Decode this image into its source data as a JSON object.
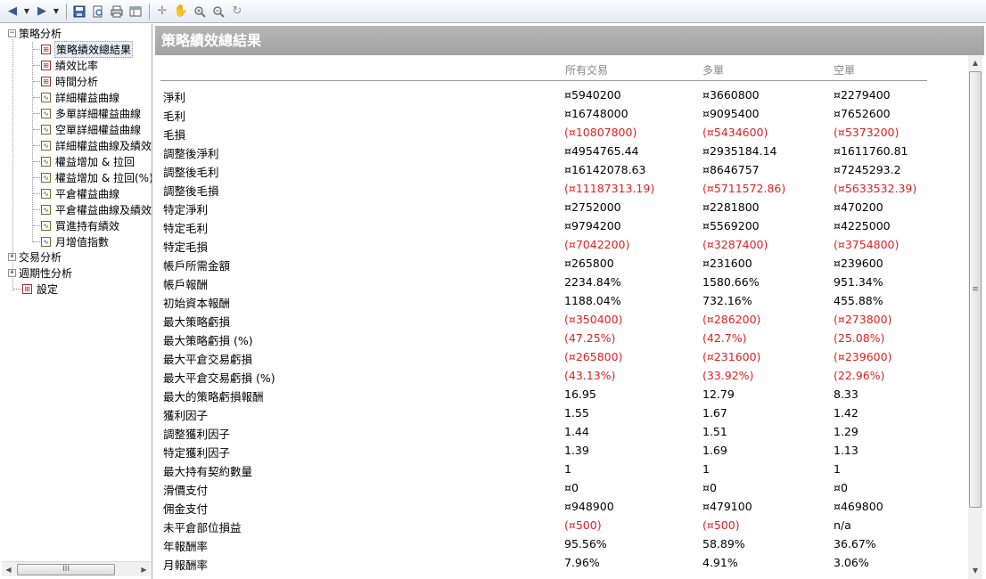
{
  "toolbar": {
    "icons": [
      "back-icon",
      "forward-icon",
      "save-icon",
      "print-preview-icon",
      "print-icon",
      "table-icon",
      "crosshair-icon",
      "pan-icon",
      "zoom-in-icon",
      "zoom-out-icon",
      "reset-icon"
    ]
  },
  "tree": {
    "root": "策略分析",
    "items": [
      "策略績效總結果",
      "績效比率",
      "時間分析",
      "詳細權益曲線",
      "多單詳細權益曲線",
      "空單詳細權益曲線",
      "詳細權益曲線及績效",
      "權益增加 & 拉回",
      "權益增加 & 拉回(%)",
      "平倉權益曲線",
      "平倉權益曲線及績效",
      "買進持有績效",
      "月增值指數"
    ],
    "others": [
      "交易分析",
      "週期性分析",
      "設定"
    ],
    "scroll_thumb": "III"
  },
  "main": {
    "title": "策略績效總結果",
    "columns": [
      "所有交易",
      "多單",
      "空單"
    ],
    "rows": [
      {
        "label": "淨利",
        "all": "¤5940200",
        "long": "¤3660800",
        "short": "¤2279400",
        "neg": false
      },
      {
        "label": "毛利",
        "all": "¤16748000",
        "long": "¤9095400",
        "short": "¤7652600",
        "neg": false
      },
      {
        "label": "毛損",
        "all": "(¤10807800)",
        "long": "(¤5434600)",
        "short": "(¤5373200)",
        "neg": true
      },
      {
        "label": "調整後淨利",
        "all": "¤4954765.44",
        "long": "¤2935184.14",
        "short": "¤1611760.81",
        "neg": false
      },
      {
        "label": "調整後毛利",
        "all": "¤16142078.63",
        "long": "¤8646757",
        "short": "¤7245293.2",
        "neg": false
      },
      {
        "label": "調整後毛損",
        "all": "(¤11187313.19)",
        "long": "(¤5711572.86)",
        "short": "(¤5633532.39)",
        "neg": true
      },
      {
        "label": "特定淨利",
        "all": "¤2752000",
        "long": "¤2281800",
        "short": "¤470200",
        "neg": false
      },
      {
        "label": "特定毛利",
        "all": "¤9794200",
        "long": "¤5569200",
        "short": "¤4225000",
        "neg": false
      },
      {
        "label": "特定毛損",
        "all": "(¤7042200)",
        "long": "(¤3287400)",
        "short": "(¤3754800)",
        "neg": true
      },
      {
        "label": "帳戶所需金額",
        "all": "¤265800",
        "long": "¤231600",
        "short": "¤239600",
        "neg": false
      },
      {
        "label": "帳戶報酬",
        "all": "2234.84%",
        "long": "1580.66%",
        "short": "951.34%",
        "neg": false
      },
      {
        "label": "初始資本報酬",
        "all": "1188.04%",
        "long": "732.16%",
        "short": "455.88%",
        "neg": false
      },
      {
        "label": "最大策略虧損",
        "all": "(¤350400)",
        "long": "(¤286200)",
        "short": "(¤273800)",
        "neg": true
      },
      {
        "label": "最大策略虧損 (%)",
        "all": "(47.25%)",
        "long": "(42.7%)",
        "short": "(25.08%)",
        "neg": true
      },
      {
        "label": "最大平倉交易虧損",
        "all": "(¤265800)",
        "long": "(¤231600)",
        "short": "(¤239600)",
        "neg": true
      },
      {
        "label": "最大平倉交易虧損 (%)",
        "all": "(43.13%)",
        "long": "(33.92%)",
        "short": "(22.96%)",
        "neg": true
      },
      {
        "label": "最大的策略虧損報酬",
        "all": "16.95",
        "long": "12.79",
        "short": "8.33",
        "neg": false
      },
      {
        "label": "獲利因子",
        "all": "1.55",
        "long": "1.67",
        "short": "1.42",
        "neg": false
      },
      {
        "label": "調整獲利因子",
        "all": "1.44",
        "long": "1.51",
        "short": "1.29",
        "neg": false
      },
      {
        "label": "特定獲利因子",
        "all": "1.39",
        "long": "1.69",
        "short": "1.13",
        "neg": false
      },
      {
        "label": "最大持有契約數量",
        "all": "1",
        "long": "1",
        "short": "1",
        "neg": false
      },
      {
        "label": "滑價支付",
        "all": "¤0",
        "long": "¤0",
        "short": "¤0",
        "neg": false
      },
      {
        "label": "佣金支付",
        "all": "¤948900",
        "long": "¤479100",
        "short": "¤469800",
        "neg": false
      },
      {
        "label": "未平倉部位損益",
        "all": "(¤500)",
        "long": "(¤500)",
        "short": "n/a",
        "neg": true
      },
      {
        "label": "年報酬率",
        "all": "95.56%",
        "long": "58.89%",
        "short": "36.67%",
        "neg": false
      },
      {
        "label": "月報酬率",
        "all": "7.96%",
        "long": "4.91%",
        "short": "3.06%",
        "neg": false
      }
    ],
    "scroll_thumb": "≡"
  },
  "colors": {
    "negative": "#e02020",
    "title_bg": "#a8a8a8",
    "column_header": "#888888"
  }
}
